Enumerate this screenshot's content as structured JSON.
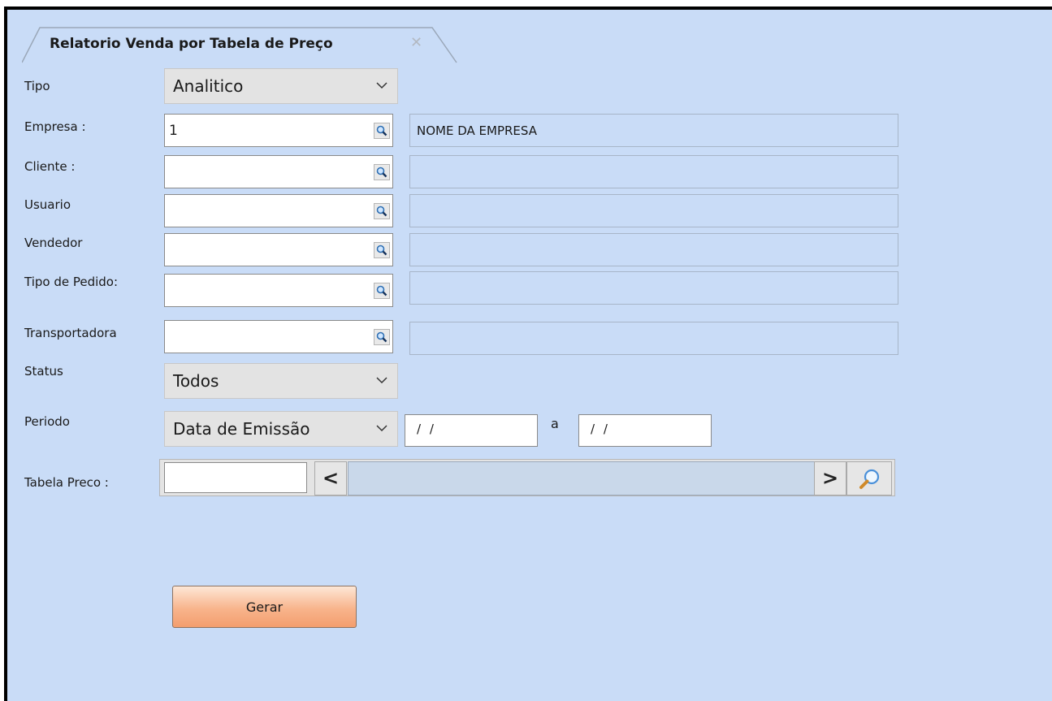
{
  "tab": {
    "title": "Relatorio Venda por Tabela de Preço",
    "close_glyph": "✕"
  },
  "form": {
    "tipo": {
      "label": "Tipo",
      "value": "Analitico"
    },
    "empresa": {
      "label": "Empresa :",
      "code": "1",
      "name": "NOME DA EMPRESA"
    },
    "cliente": {
      "label": "Cliente :",
      "code": "",
      "name": ""
    },
    "usuario": {
      "label": "Usuario",
      "code": "",
      "name": ""
    },
    "vendedor": {
      "label": "Vendedor",
      "code": "",
      "name": ""
    },
    "tipo_pedido": {
      "label": "Tipo de Pedido:",
      "code": "",
      "name": ""
    },
    "transportadora": {
      "label": "Transportadora",
      "code": "",
      "name": ""
    },
    "status": {
      "label": "Status",
      "value": "Todos"
    },
    "periodo": {
      "label": "Periodo",
      "value": "Data de Emissão",
      "from": "/ /",
      "separator": "a",
      "to": "/ /"
    },
    "tabela_preco": {
      "label": "Tabela Preco :",
      "code": "",
      "prev_glyph": "<",
      "next_glyph": ">"
    }
  },
  "actions": {
    "gerar_label": "Gerar"
  },
  "icons": {
    "lookup": "magnifier-lookup-icon",
    "search": "search-icon",
    "dropdown": "chevron-down-icon"
  },
  "colors": {
    "background": "#c9dcf7",
    "button_gradient_end": "#f39e6e"
  }
}
